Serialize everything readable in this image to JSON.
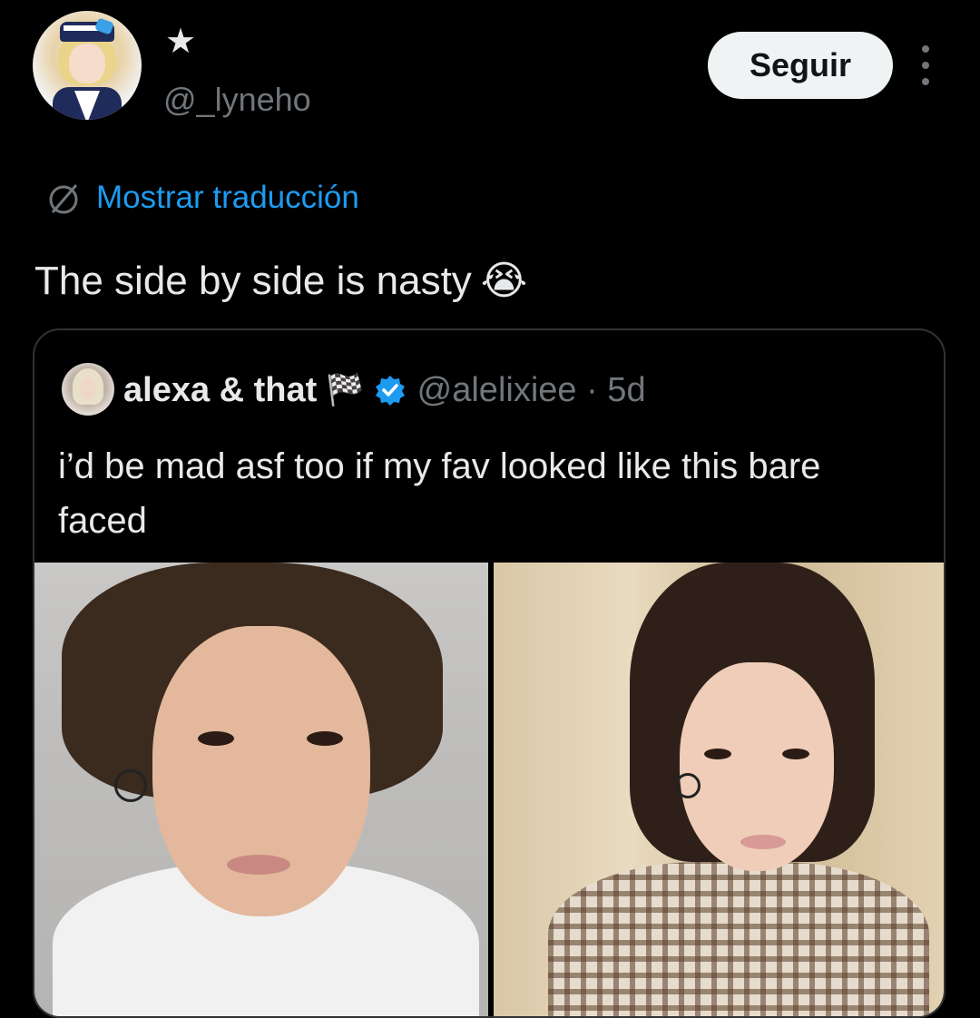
{
  "post": {
    "star_glyph": "★",
    "handle": "@_lyneho",
    "follow_label": "Seguir",
    "translate_label": "Mostrar traducción",
    "text": "The side by side is nasty",
    "emoji": "😭"
  },
  "quote": {
    "name": "alexa & that",
    "flag": "🏁",
    "handle_time": "@alelixiee · 5d",
    "text": "i’d be mad asf too if my fav looked like this bare faced"
  },
  "colors": {
    "background": "#000000",
    "link": "#1d9bf0",
    "secondary_text": "#71767b",
    "follow_button": "#eff3f4",
    "verified": "#1d9bf0"
  },
  "icons": [
    "more-icon",
    "translate-icon",
    "verified-badge-icon"
  ]
}
